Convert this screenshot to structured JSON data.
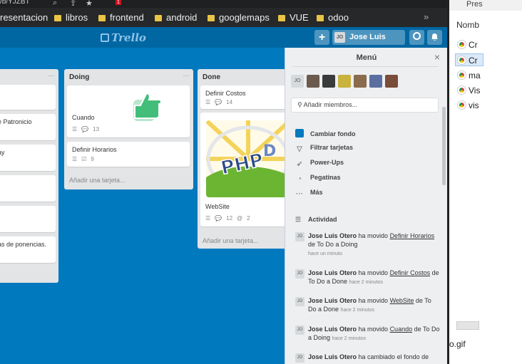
{
  "browser": {
    "url_fragment": "/b/YJZBT",
    "tab_badge": "1",
    "bookmarks": [
      "resentacion",
      "libros",
      "frontend",
      "android",
      "googlemaps",
      "VUE",
      "odoo"
    ],
    "more": "»"
  },
  "header": {
    "logo": "Trello",
    "add": "+",
    "user_initials": "JO",
    "user_name": "Jose Luis Otero"
  },
  "lists": {
    "left": {
      "dots": "...",
      "cards": [
        "",
        "e Patronicio",
        "ay",
        "",
        "",
        "as de ponencias."
      ]
    },
    "doing": {
      "title": "Doing",
      "dots": "...",
      "cards": [
        {
          "title": "Cuando",
          "comments": "13"
        },
        {
          "title": "Definir Horarios",
          "checklist": "9"
        }
      ],
      "add": "Añadir una tarjeta..."
    },
    "done": {
      "title": "Done",
      "cards": [
        {
          "title": "Definir Costos",
          "comments": "14"
        },
        {
          "title": "WebSite",
          "comments": "12",
          "attachments": "2",
          "image_text": "PHP"
        }
      ],
      "add": "Añadir una tarjeta..."
    }
  },
  "menu": {
    "title": "Menú",
    "close": "×",
    "member_initials": "JO",
    "add_members": "Añadir miembros...",
    "items": [
      {
        "label": "Cambiar fondo",
        "icon": "color-square-icon"
      },
      {
        "label": "Filtrar tarjetas",
        "icon": "filter-icon"
      },
      {
        "label": "Power-Ups",
        "icon": "rocket-icon"
      },
      {
        "label": "Pegatinas",
        "icon": "sticker-icon"
      },
      {
        "label": "Más",
        "icon": "more-icon"
      }
    ],
    "activity_title": "Actividad",
    "activities": [
      {
        "user": "Jose Luis Otero",
        "pre": " ha movido ",
        "link": "Definir Horarios",
        "post": " de To Do a Doing",
        "time": "hace un minuto"
      },
      {
        "user": "Jose Luis Otero",
        "pre": " ha movido ",
        "link": "Definir Costos",
        "post": " de To Do a Done",
        "time": "hace 2 minutos"
      },
      {
        "user": "Jose Luis Otero",
        "pre": " ha movido ",
        "link": "WebSite",
        "post": " de To Do a Done",
        "time": "hace 2 minutos"
      },
      {
        "user": "Jose Luis Otero",
        "pre": " ha movido ",
        "link": "Cuando",
        "post": " de To Do a Doing",
        "time": "hace 2 minutos"
      },
      {
        "user": "Jose Luis Otero",
        "pre": " ha cambiado el fondo de",
        "link": "",
        "post": "",
        "time": ""
      }
    ]
  },
  "explorer": {
    "top": "Pres",
    "column": "Nomb",
    "files": [
      "Cr",
      "Cr",
      "ma",
      "Vis",
      "vis"
    ],
    "bottom_file": "o.gif"
  },
  "colors": {
    "board": "#0079bf",
    "header": "#0067a3",
    "accent": "#0079bf"
  }
}
